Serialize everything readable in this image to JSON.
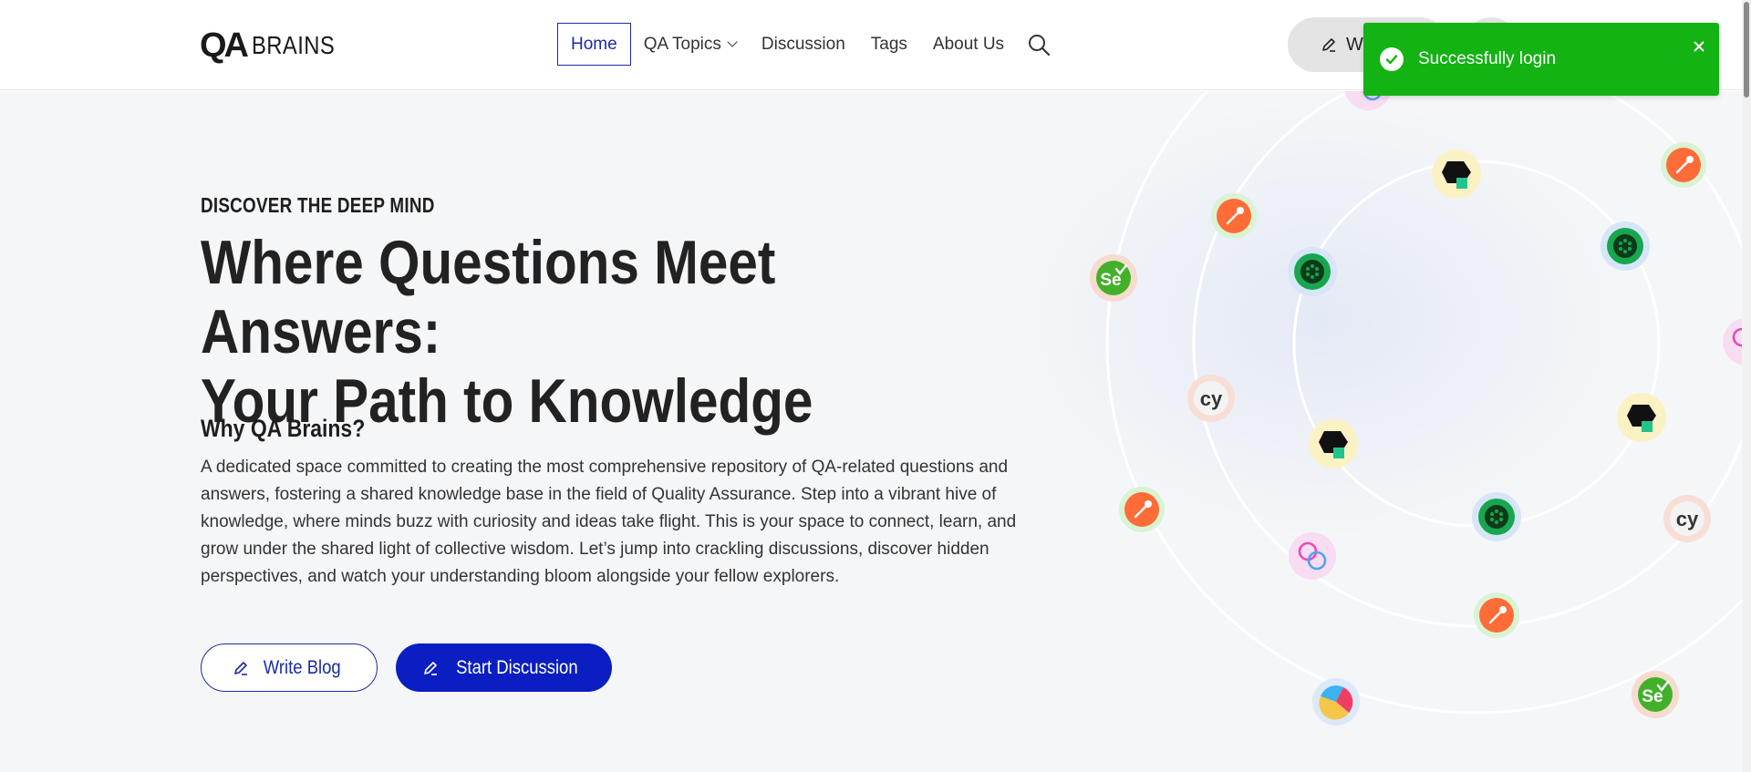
{
  "brand": {
    "mark": "QA",
    "name": "BRAINS"
  },
  "nav": {
    "items": [
      {
        "label": "Home"
      },
      {
        "label": "QA Topics"
      },
      {
        "label": "Discussion"
      },
      {
        "label": "Tags"
      },
      {
        "label": "About Us"
      }
    ]
  },
  "header_actions": {
    "write_label": "W"
  },
  "toast": {
    "message": "Successfully login",
    "color": "#12b312"
  },
  "hero": {
    "eyebrow": "DISCOVER THE DEEP MIND",
    "headline_line1": "Where Questions Meet Answers:",
    "headline_line2": "Your Path to Knowledge",
    "why_title": "Why QA Brains?",
    "why_body": "A dedicated space committed to creating the most comprehensive repository of QA-related questions and answers, fostering a shared knowledge base in the field of Quality Assurance. Step into a vibrant hive of knowledge, where minds buzz with curiosity and ideas take flight. This is your space to connect, learn, and grow under the shared light of collective wisdom. Let’s jump into crackling discussions, discover hidden perspectives, and watch your understanding bloom alongside your fellow explorers.",
    "write_blog_label": "Write Blog",
    "start_discussion_label": "Start Discussion"
  },
  "colors": {
    "primary": "#0a1ec2",
    "accent_outline": "#1a2ba8",
    "hero_bg": "#f5f6f8"
  }
}
